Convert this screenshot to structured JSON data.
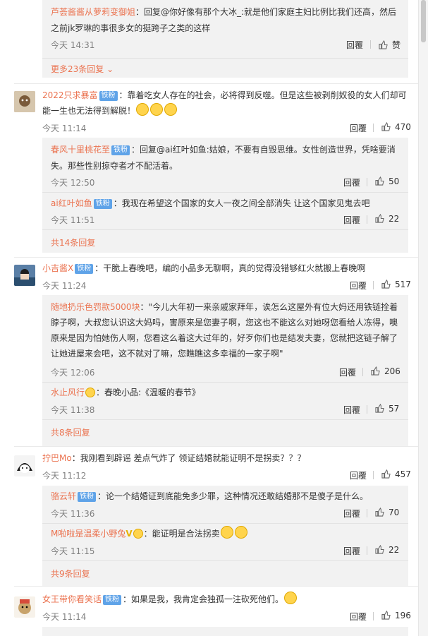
{
  "comments": [
    {
      "id": "c0",
      "replies": [
        {
          "name": "芦荟酱酱从萝莉变御姐",
          "line1": "：回复@你好像有那个大冰_:就是他们家庭主妇比例比我们还高，然后",
          "line2": "之前jk罗琳的事很多女的挺跨子之类的这样",
          "time": "今天 14:31",
          "reply": "回覆",
          "likes": "赞"
        }
      ],
      "more": "更多23条回复"
    },
    {
      "id": "c1",
      "user": "2022只求暴富",
      "badge": "铁粉",
      "line1": "：靠着吃女人存在的社会，必将得到反噬。但是这些被剥削奴役的女人们却可",
      "line2": "能一生也无法得到解脱！",
      "time": "今天 11:14",
      "reply": "回覆",
      "likes": "470",
      "replies": [
        {
          "name": "春风十里桃花至",
          "badge": "铁粉",
          "line1": "：回复@ai红叶如鱼:姑娘，不要有自毁思维。女性创造世界，凭啥要消",
          "line2": "失。那些性别掠夺者才不配活着。",
          "time": "今天 12:50",
          "reply": "回覆",
          "likes": "50"
        },
        {
          "name": "ai红叶如鱼",
          "badge": "铁粉",
          "line1": "：我现在希望这个国家的女人一夜之间全部消失 让这个国家见鬼去吧",
          "time": "今天 11:51",
          "reply": "回覆",
          "likes": "22"
        }
      ],
      "more": "共14条回复"
    },
    {
      "id": "c2",
      "user": "小吉酱X",
      "badge": "铁粉",
      "line1": "：干脆上春晚吧，编的小品多无聊啊，真的觉得没错够红火就搬上春晚啊",
      "time": "今天 11:24",
      "reply": "回覆",
      "likes": "517",
      "replies": [
        {
          "name": "随地扔乐色罚款5000块",
          "line1": "：\"今儿大年初一来亲戚家拜年，诶怎么这屋外有位大妈还用铁链拴着",
          "line2": "脖子啊，大叔您认识这大妈吗，害原来是您妻子啊，您这也不能这么对她呀您看给人冻得，噢",
          "line3": "原来是因为怕她伤人啊，您看这么着这大过年的，好歹你们也是结发夫妻，您就把这链子解了",
          "line4": "让她进屋来会吧，这不就对了嘛，您瞧瞧这多幸福的一家子啊\"",
          "time": "今天 12:06",
          "reply": "回覆",
          "likes": "206"
        },
        {
          "name": "水止风行",
          "line1": "：春晚小品:《温暖的春节》",
          "time": "今天 11:38",
          "reply": "回覆",
          "likes": "57"
        }
      ],
      "more": "共8条回复"
    },
    {
      "id": "c3",
      "user": "拧巴Mo",
      "line1": "：我刚看到辟谣 差点气炸了 领证结婚就能证明不是拐卖？？？",
      "time": "今天 11:12",
      "reply": "回覆",
      "likes": "457",
      "replies": [
        {
          "name": "骆云轩",
          "badge": "铁粉",
          "line1": "：论一个结婚证到底能免多少罪，这种情况还敢结婚那不是傻子是什么。",
          "time": "今天 11:36",
          "reply": "回覆",
          "likes": "70"
        },
        {
          "name": "M啦啦是温柔小野兔",
          "line1": "：能证明是合法拐卖",
          "time": "今天 11:15",
          "reply": "回覆",
          "likes": "22"
        }
      ],
      "more": "共9条回复"
    },
    {
      "id": "c4",
      "user": "女王带你看笑话",
      "badge": "铁粉",
      "line1": "：如果是我，我肯定会独孤一注砍死他们。",
      "time": "今天 11:14",
      "reply": "回覆",
      "likes": "196"
    }
  ],
  "colors": {
    "name": "#eb7350",
    "badge": "#5fa3e8",
    "subbg": "#f2f2f2"
  }
}
